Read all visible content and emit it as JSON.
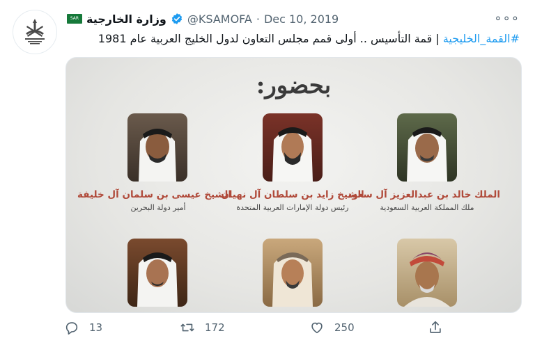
{
  "account": {
    "name": "وزارة الخارجية",
    "flag_label": "SAR",
    "handle": "@KSAMOFA",
    "separator": "·",
    "date": "Dec 10, 2019",
    "verified": true,
    "avatar_icon": "ministry-emblem-logo"
  },
  "tweet": {
    "hashtag": "#القمة_الخليجية",
    "body": " | قمة التأسيس .. أولى قمم مجلس التعاون لدول الخليج العربية عام 1981"
  },
  "media": {
    "heading": "بحضور:",
    "people": [
      {
        "name": "الملك خالد بن عبدالعزيز آل سعود",
        "title": "ملك المملكة العربية السعودية"
      },
      {
        "name": "الشيخ زايد بن سلطان آل نهيان",
        "title": "رئيس دولة الإمارات العربية المتحدة"
      },
      {
        "name": "الشيخ عيسى بن سلمان آل خليفة",
        "title": "أمير دولة البحرين"
      }
    ],
    "name_color": "#b04a3a"
  },
  "actions": {
    "reply_count": "13",
    "retweet_count": "172",
    "like_count": "250",
    "icons": [
      "reply-icon",
      "retweet-icon",
      "like-icon",
      "share-icon"
    ]
  },
  "colors": {
    "link": "#1d9bf0",
    "muted": "#536471",
    "text": "#0f1419"
  }
}
